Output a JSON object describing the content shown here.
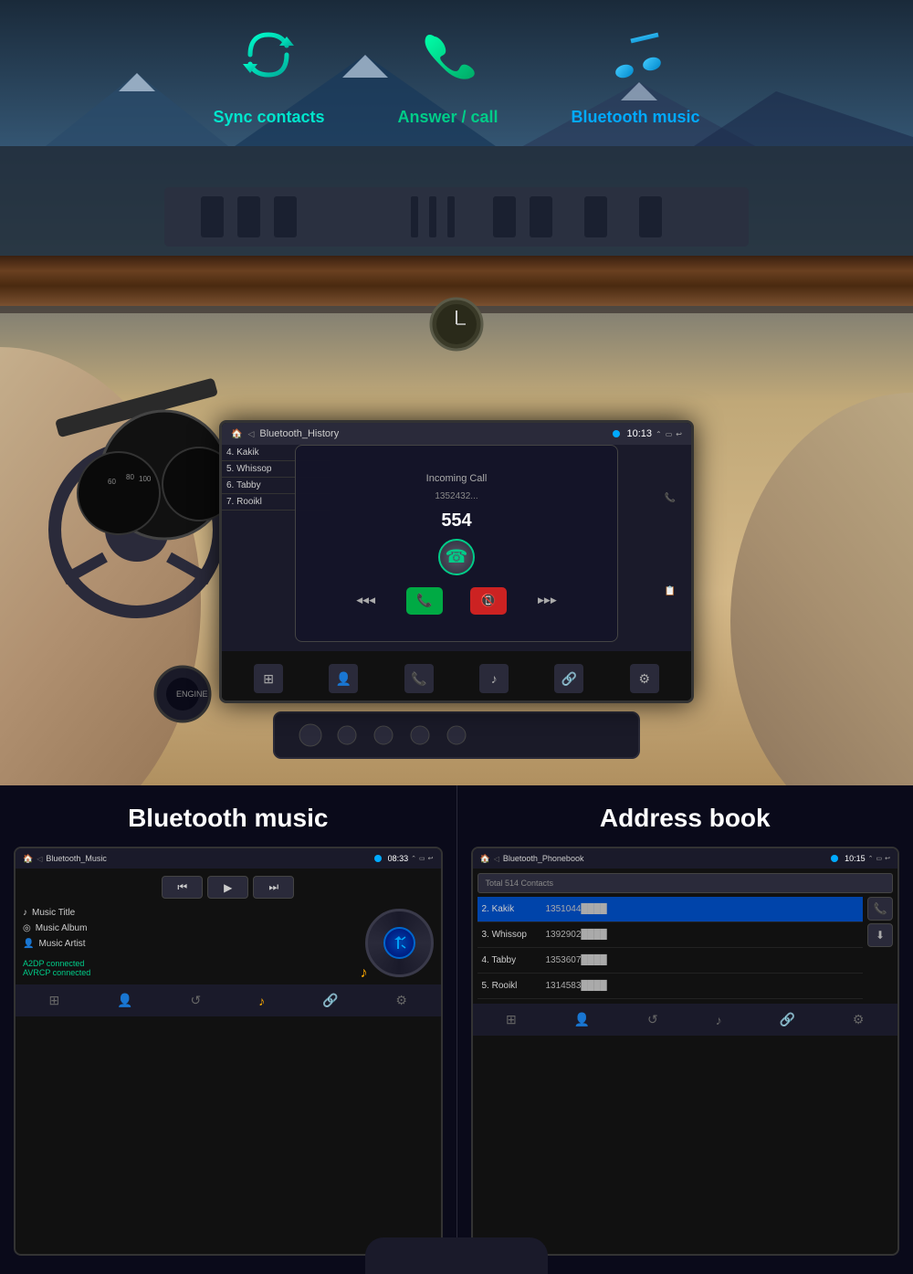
{
  "features": [
    {
      "id": "sync",
      "icon": "🔄",
      "label": "Sync contacts",
      "color": "#00e5cc"
    },
    {
      "id": "call",
      "icon": "📞",
      "label": "Answer / call",
      "color": "#00cc88"
    },
    {
      "id": "music",
      "icon": "🎵",
      "label": "Bluetooth music",
      "color": "#00aaff"
    }
  ],
  "car_screen": {
    "status_bar": {
      "title": "Bluetooth_History",
      "time": "10:13"
    },
    "contacts": [
      {
        "id": 4,
        "name": "Kakik"
      },
      {
        "id": 5,
        "name": "Whissop"
      },
      {
        "id": 6,
        "name": "Tabby"
      },
      {
        "id": 7,
        "name": "Rooikl"
      }
    ],
    "incoming_call": {
      "label": "Incoming Call",
      "number": "554",
      "extra_number": "1352432..."
    }
  },
  "bluetooth_music": {
    "title": "Bluetooth music",
    "screen": {
      "title": "Bluetooth_Music",
      "time": "08:33",
      "transport": {
        "prev": "⏮",
        "play": "▶",
        "next": "⏭"
      },
      "track": {
        "title": "Music Title",
        "album": "Music Album",
        "artist": "Music Artist"
      },
      "status": [
        "A2DP connected",
        "AVRCP connected"
      ]
    },
    "nav_icons": [
      "⊞",
      "👤",
      "↺",
      "🎵",
      "🔗",
      "⚙"
    ]
  },
  "address_book": {
    "title": "Address book",
    "screen": {
      "title": "Bluetooth_Phonebook",
      "time": "10:15",
      "search_placeholder": "Total 514 Contacts",
      "contacts": [
        {
          "id": 2,
          "name": "Kakik",
          "number": "1351044████"
        },
        {
          "id": 3,
          "name": "Whissop",
          "number": "1392902████"
        },
        {
          "id": 4,
          "name": "Tabby",
          "number": "1353607████"
        },
        {
          "id": 5,
          "name": "Rooikl",
          "number": "1314583████"
        }
      ],
      "action_buttons": [
        "📞",
        "⬇"
      ]
    },
    "nav_icons": [
      "⊞",
      "👤",
      "↺",
      "🎵",
      "🔗",
      "⚙"
    ]
  },
  "icons": {
    "phone": "📞",
    "music_note": "♪",
    "album": "💿",
    "person": "👤",
    "settings": "⚙",
    "home": "🏠",
    "bluetooth": "🔵",
    "link": "🔗",
    "refresh": "↺",
    "grid": "⊞",
    "download": "⬇"
  }
}
